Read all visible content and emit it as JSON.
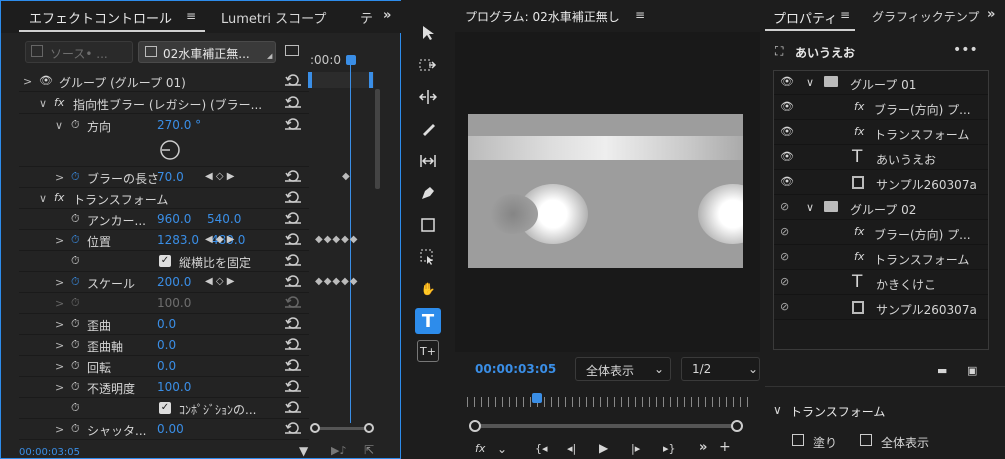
{
  "effect_controls": {
    "tab_effect": "エフェクトコントロール",
    "tab_lumetri": "Lumetri スコープ",
    "tab_more": "テ",
    "source_label": "ソース• ...",
    "sequence_label": "02水車補正無...",
    "timecode_head": ":00:0",
    "rows": [
      {
        "label": "グループ (グループ 01)"
      },
      {
        "label": "指向性ブラー (レガシー) (ブラー..."
      },
      {
        "label": "方向",
        "value": "270.0 °"
      },
      {
        "label": "ブラーの長さ",
        "value": "70.0"
      },
      {
        "label": "トランスフォーム"
      },
      {
        "label": "アンカー...",
        "value": "960.0",
        "value2": "540.0"
      },
      {
        "label": "位置",
        "value": "1283.0",
        "value2": "480.0"
      },
      {
        "label": "縦横比を固定"
      },
      {
        "label": "スケール",
        "value": "200.0"
      },
      {
        "label": "",
        "value": "100.0"
      },
      {
        "label": "歪曲",
        "value": "0.0"
      },
      {
        "label": "歪曲軸",
        "value": "0.0"
      },
      {
        "label": "回転",
        "value": "0.0"
      },
      {
        "label": "不透明度",
        "value": "100.0"
      },
      {
        "label": "ｺﾝﾎﾟｼﾞｼｮﾝの..."
      },
      {
        "label": "シャッタ...",
        "value": "0.00"
      }
    ],
    "footer_timecode": "00:00:03:05"
  },
  "program": {
    "title": "プログラム: 02水車補正無し",
    "timecode": "00:00:03:05",
    "zoom": "全体表示",
    "resolution": "1/2"
  },
  "properties": {
    "tab": "プロパティ",
    "tab2": "グラフィックテンプ",
    "object_name": "あいうえお",
    "layers": [
      {
        "name": "グループ 01",
        "type": "group",
        "visible": true
      },
      {
        "name": "ブラー(方向) プ...",
        "type": "fx",
        "visible": true
      },
      {
        "name": "トランスフォーム",
        "type": "fx",
        "visible": true
      },
      {
        "name": "あいうえお",
        "type": "text",
        "visible": true
      },
      {
        "name": "サンプル260307a",
        "type": "clip",
        "visible": true
      },
      {
        "name": "グループ 02",
        "type": "group",
        "visible": false
      },
      {
        "name": "ブラー(方向) プ...",
        "type": "fx",
        "visible": false
      },
      {
        "name": "トランスフォーム",
        "type": "fx",
        "visible": false
      },
      {
        "name": "かきくけこ",
        "type": "text",
        "visible": false
      },
      {
        "name": "サンプル260307a",
        "type": "clip",
        "visible": false
      }
    ],
    "section_transform": "トランスフォーム",
    "fill_label": "塗り",
    "fit_label": "全体表示"
  },
  "colors": {
    "accent": "#3a8ee6",
    "panel": "#232323",
    "bg": "#1d1d1d"
  }
}
